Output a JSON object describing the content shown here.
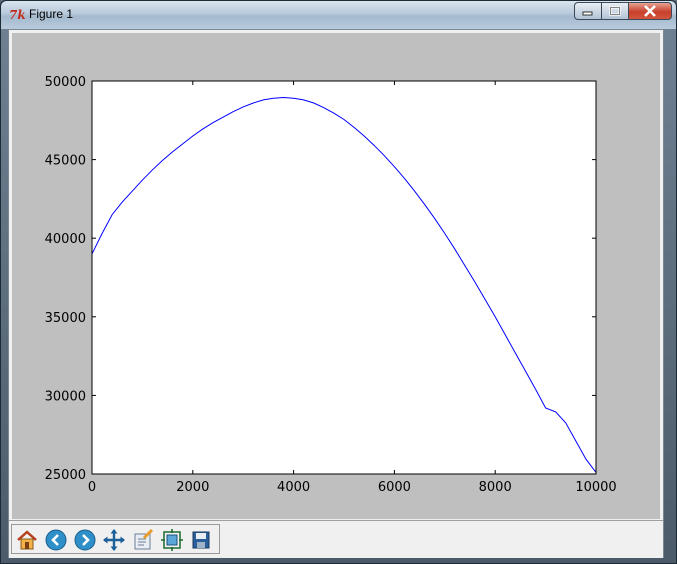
{
  "window": {
    "title": "Figure 1",
    "app_icon": "tk-feather-icon",
    "caption_buttons": [
      "minimize-icon",
      "maximize-icon",
      "close-icon"
    ]
  },
  "toolbar": {
    "buttons": [
      {
        "icon": "home-icon"
      },
      {
        "icon": "back-arrow-icon"
      },
      {
        "icon": "forward-arrow-icon"
      },
      {
        "icon": "pan-move-icon"
      },
      {
        "icon": "zoom-rect-icon"
      },
      {
        "icon": "configure-subplots-icon"
      },
      {
        "icon": "save-icon"
      }
    ]
  },
  "colors": {
    "figure_bg": "#bfbfbf",
    "axes_bg": "#ffffff",
    "line": "#0000ff"
  },
  "chart_data": {
    "type": "line",
    "title": "",
    "xlabel": "",
    "ylabel": "",
    "xlim": [
      0,
      10000
    ],
    "ylim": [
      25000,
      50000
    ],
    "xticks": [
      "0",
      "2000",
      "4000",
      "6000",
      "8000",
      "10000"
    ],
    "yticks": [
      "25000",
      "30000",
      "35000",
      "40000",
      "45000",
      "50000"
    ],
    "grid": false,
    "legend": "none",
    "series": [
      {
        "x": [
          0,
          200,
          400,
          600,
          800,
          1000,
          1200,
          1400,
          1600,
          1800,
          2000,
          2200,
          2400,
          2600,
          2800,
          3000,
          3200,
          3400,
          3600,
          3800,
          4000,
          4200,
          4400,
          4600,
          4800,
          5000,
          5200,
          5400,
          5600,
          5800,
          6000,
          6200,
          6400,
          6600,
          6800,
          7000,
          7200,
          7400,
          7600,
          7800,
          8000,
          8200,
          8400,
          8600,
          8800,
          9000,
          9200,
          9400,
          9600,
          9800,
          10000
        ],
        "y": [
          39000,
          40300,
          41500,
          42300,
          43000,
          43700,
          44350,
          44950,
          45500,
          46000,
          46500,
          46950,
          47350,
          47700,
          48050,
          48350,
          48600,
          48800,
          48900,
          48950,
          48900,
          48800,
          48600,
          48300,
          47950,
          47550,
          47050,
          46500,
          45900,
          45250,
          44550,
          43800,
          43000,
          42150,
          41250,
          40300,
          39300,
          38250,
          37200,
          36100,
          35000,
          33850,
          32700,
          31550,
          30400,
          29200,
          28950,
          28250,
          27100,
          25950,
          25100
        ]
      }
    ]
  }
}
